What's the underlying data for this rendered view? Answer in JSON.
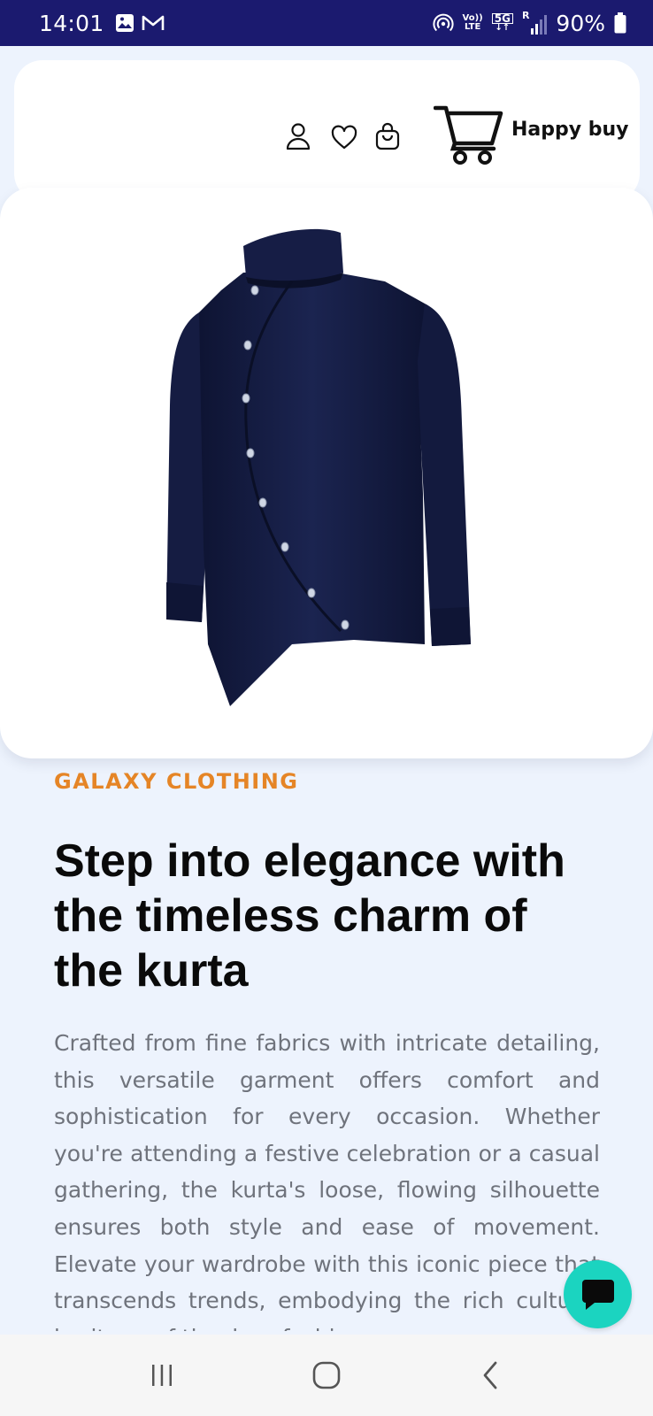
{
  "status_bar": {
    "time": "14:01",
    "left_icons": [
      "gallery-icon",
      "gmail-icon"
    ],
    "right_icons": [
      "hotspot-icon",
      "volte-icon",
      "5g-icon",
      "roaming-signal-icon",
      "battery-icon"
    ],
    "volte_line1": "Vo))",
    "volte_line2": "LTE",
    "network": "5G",
    "roaming": "R",
    "battery": "90%"
  },
  "header": {
    "icons": [
      "user-icon",
      "heart-icon",
      "bag-icon"
    ],
    "logo_text": "Happy buy"
  },
  "product": {
    "image": "navy-asymmetric-shirt",
    "brand": "GALAXY CLOTHING",
    "title": "Step into elegance with the timeless charm of the kurta",
    "description": "Crafted from fine fabrics with intricate detailing, this versatile garment offers comfort and sophistication for every occasion. Whether you're attending a festive celebration or a casual gathering, the kurta's loose, flowing silhouette ensures both style and ease of movement. Elevate your wardrobe with this iconic piece that transcends trends, embodying the rich cultural heritage of timeless fashion."
  },
  "chat_button": {
    "icon": "chat-bubble-icon"
  },
  "nav": {
    "buttons": [
      "recent-apps",
      "home",
      "back"
    ]
  },
  "colors": {
    "status_bar": "#1b1a6f",
    "background": "#edf3fd",
    "brand_accent": "#e58526",
    "fab": "#1bd4c0",
    "shirt": "#141b3f"
  }
}
